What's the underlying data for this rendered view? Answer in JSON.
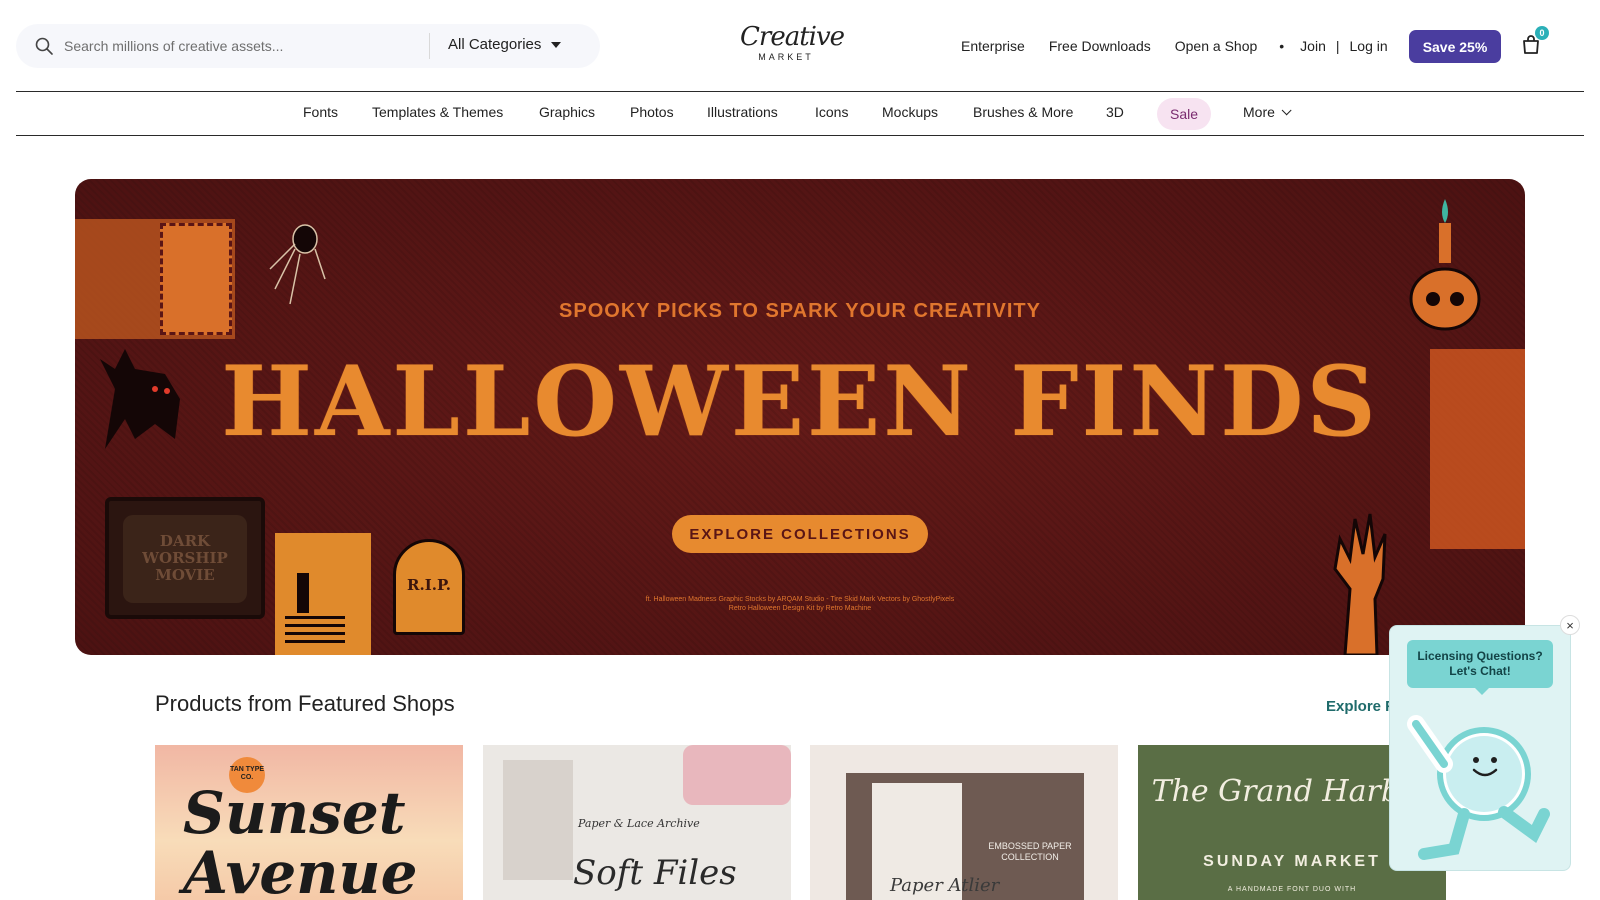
{
  "header": {
    "search_placeholder": "Search millions of creative assets...",
    "category_selector": "All Categories",
    "logo_script": "Creative",
    "logo_sub": "MARKET",
    "nav": [
      "Enterprise",
      "Free Downloads",
      "Open a Shop"
    ],
    "join": "Join",
    "separator": "|",
    "login": "Log in",
    "save_button": "Save 25%",
    "cart_count": "0"
  },
  "category_nav": {
    "items": [
      "Fonts",
      "Templates & Themes",
      "Graphics",
      "Photos",
      "Illustrations",
      "Icons",
      "Mockups",
      "Brushes & More",
      "3D"
    ],
    "sale": "Sale",
    "more": "More"
  },
  "hero": {
    "kicker": "SPOOKY PICKS TO SPARK YOUR CREATIVITY",
    "title": "HALLOWEEN FINDS",
    "cta": "EXPLORE COLLECTIONS",
    "credit_line1": "ft. Halloween Madness Graphic Stocks by ARQAM Studio - Tire Skid Mark Vectors by GhostlyPixels",
    "credit_line2": "Retro Halloween Design Kit by Retro Machine",
    "deco_tv": "DARK WORSHIP MOVIE",
    "deco_grave": "R.I.P."
  },
  "featured": {
    "title": "Products from Featured Shops",
    "explore_link": "Explore F",
    "cards": [
      {
        "title": "Sunset Avenue",
        "badge": "TAN TYPE CO."
      },
      {
        "title": "Soft Files",
        "subtitle": "Paper & Lace Archive"
      },
      {
        "title": "Paper Atlier",
        "subtitle": "EMBOSSED PAPER COLLECTION"
      },
      {
        "title": "The Grand Harbor",
        "subtitle": "SUNDAY MARKET",
        "note": "A HANDMADE FONT DUO WITH"
      }
    ]
  },
  "chat": {
    "bubble": "Licensing Questions? Let's Chat!",
    "close": "×"
  },
  "colors": {
    "save_button": "#4a3d9f",
    "hero_bg": "#5a1515",
    "hero_accent": "#e88a2f",
    "sale_pill": "#f7e3f1",
    "chat_bg": "#dff3f3"
  }
}
